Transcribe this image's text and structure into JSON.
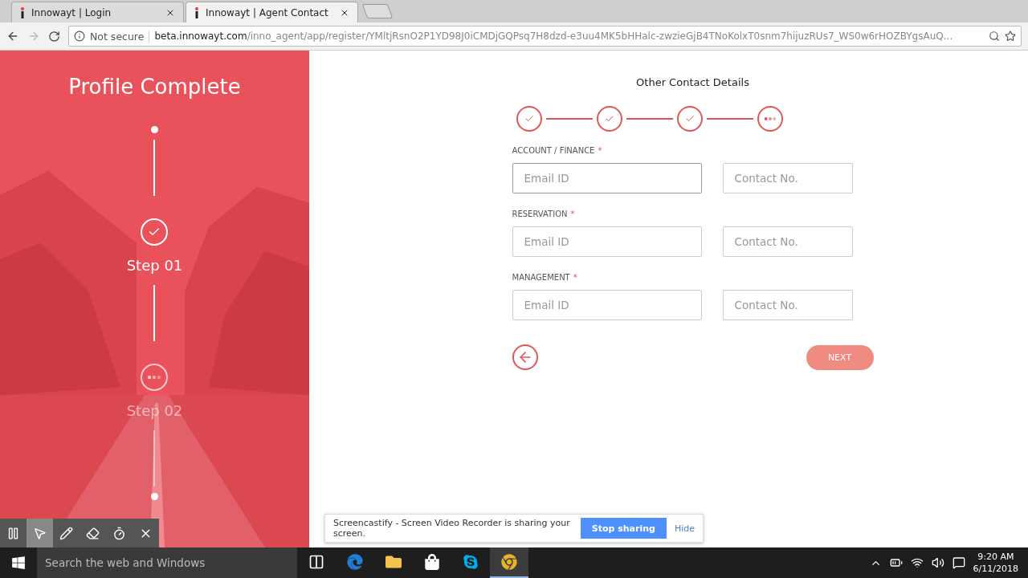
{
  "browser": {
    "tabs": [
      {
        "title": "Innowayt | Login",
        "selected": false
      },
      {
        "title": "Innowayt | Agent Contact",
        "selected": true
      }
    ],
    "address": {
      "security": "Not secure",
      "host": "beta.innowayt.com",
      "path": "/inno_agent/app/register/YMltjRsnO2P1YD98J0iCMDjGQPsq7H8dzd-e3uu4MK5bHHalc-zwzieGjB4TNoKolxT0snm7hijuzRUs7_WS0w6rHOZBYgsAuQ..."
    }
  },
  "sidebar": {
    "title": "Profile Complete",
    "steps": [
      {
        "label": "Step 01",
        "done": true
      },
      {
        "label": "Step 02",
        "done": false
      }
    ]
  },
  "form": {
    "heading": "Other Contact Details",
    "stepper": [
      {
        "done": true
      },
      {
        "done": true
      },
      {
        "done": true
      },
      {
        "done": false
      }
    ],
    "sections": [
      {
        "label": "ACCOUNT / FINANCE",
        "required": true,
        "email": {
          "placeholder": "Email ID",
          "focused": true
        },
        "contact": {
          "placeholder": "Contact No.",
          "focused": false
        }
      },
      {
        "label": "RESERVATION",
        "required": true,
        "email": {
          "placeholder": "Email ID",
          "focused": false
        },
        "contact": {
          "placeholder": "Contact No.",
          "focused": false
        }
      },
      {
        "label": "MANAGEMENT",
        "required": true,
        "email": {
          "placeholder": "Email ID",
          "focused": false
        },
        "contact": {
          "placeholder": "Contact No.",
          "focused": false
        }
      }
    ],
    "required_mark": "*",
    "next_button": "NEXT"
  },
  "sharing_bar": {
    "message": "Screencastify - Screen Video Recorder is sharing your screen.",
    "stop": "Stop sharing",
    "hide": "Hide"
  },
  "recorder_tools": [
    {
      "kind": "pause",
      "selected": false
    },
    {
      "kind": "pointer",
      "selected": true
    },
    {
      "kind": "pen",
      "selected": false
    },
    {
      "kind": "eraser",
      "selected": false
    },
    {
      "kind": "timer",
      "selected": false
    },
    {
      "kind": "close",
      "selected": false
    }
  ],
  "taskbar": {
    "search": {
      "placeholder": "Search the web and Windows"
    },
    "apps": [
      {
        "kind": "taskview",
        "active": false
      },
      {
        "kind": "edge",
        "active": false
      },
      {
        "kind": "folder",
        "active": false
      },
      {
        "kind": "store",
        "active": false
      },
      {
        "kind": "skype",
        "active": false
      },
      {
        "kind": "chrome",
        "active": true
      }
    ],
    "time": "9:20 AM",
    "date": "6/11/2018"
  }
}
